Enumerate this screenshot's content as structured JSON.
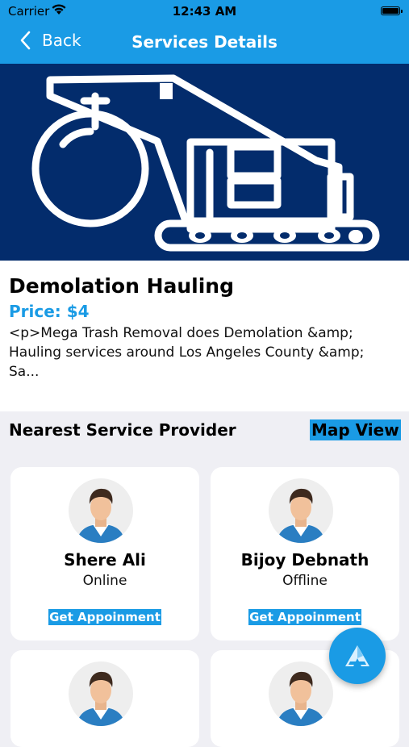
{
  "status_bar": {
    "carrier": "Carrier",
    "time": "12:43 AM"
  },
  "nav": {
    "back_label": "Back",
    "title": "Services Details"
  },
  "service": {
    "title": "Demolation Hauling",
    "price": "Price: $4",
    "description": "<p>Mega Trash Removal does Demolation &amp; Hauling services around Los Angeles County &amp; Sa..."
  },
  "providers_section": {
    "title": "Nearest Service Provider",
    "map_view_label": "Map View",
    "providers": [
      {
        "name": "Shere Ali",
        "status": "Online",
        "button": "Get Appoinment"
      },
      {
        "name": "Bijoy Debnath",
        "status": "Offline",
        "button": "Get Appoinment"
      },
      {
        "name": "",
        "status": "",
        "button": ""
      },
      {
        "name": "",
        "status": "",
        "button": ""
      }
    ]
  },
  "colors": {
    "accent": "#1a9be5",
    "hero_bg": "#032c6c",
    "page_bg": "#efeff4"
  },
  "icons": {
    "hero": "crane-wrecking-ball-icon",
    "fab": "app-logo-icon"
  }
}
